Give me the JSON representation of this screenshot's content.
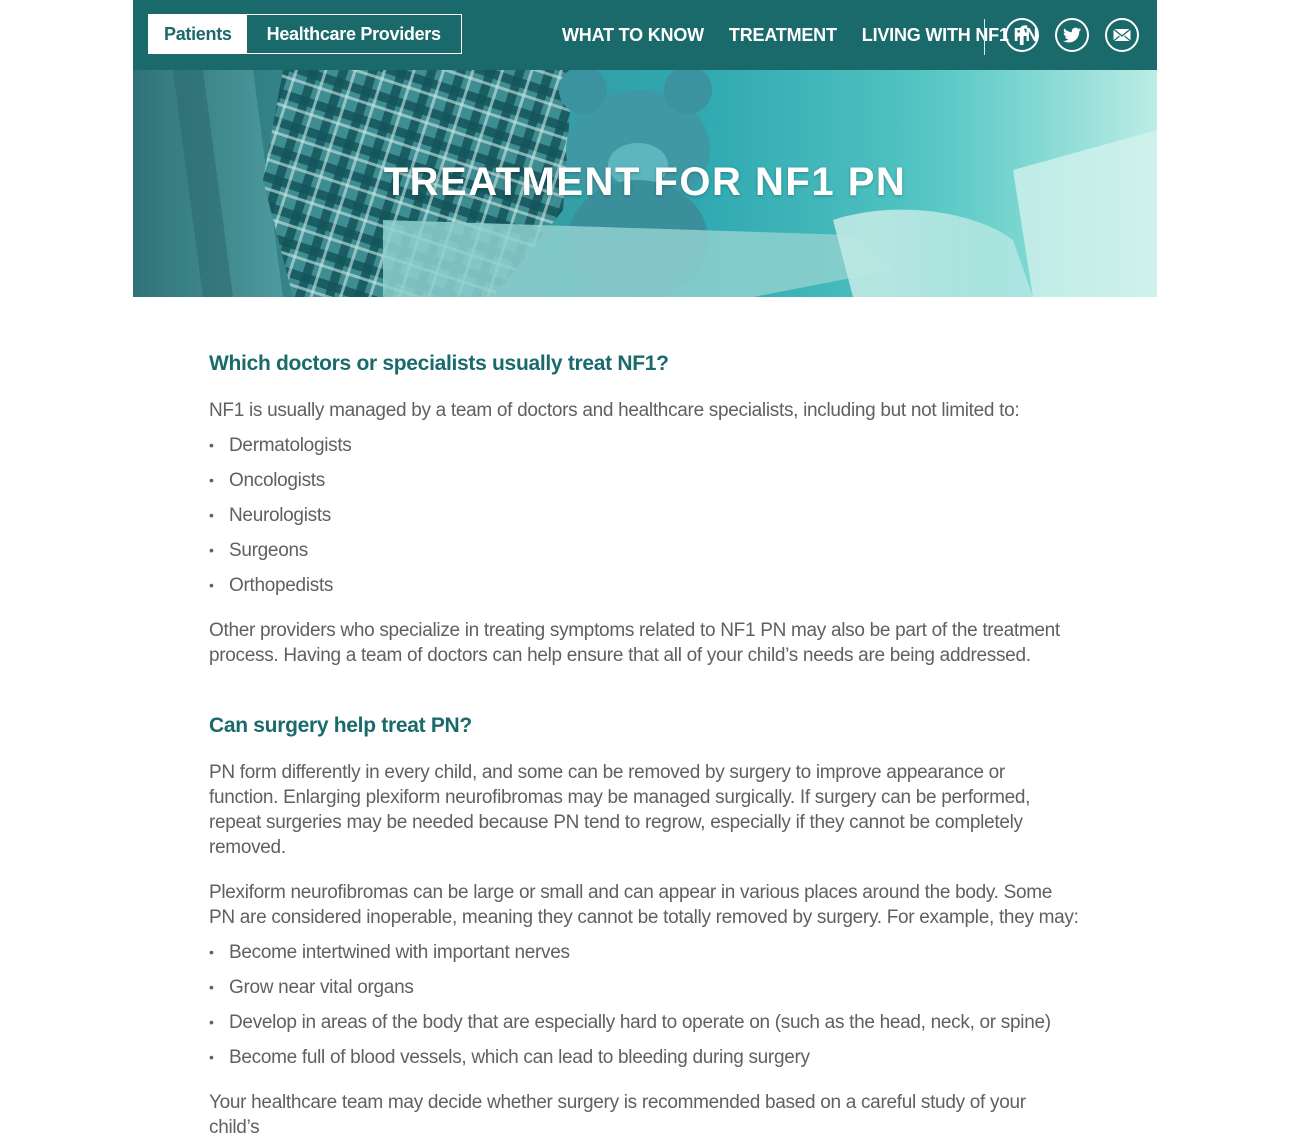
{
  "header": {
    "audience_tabs": [
      {
        "label": "Patients"
      },
      {
        "label": "Healthcare Providers"
      }
    ],
    "nav": [
      {
        "label": "WHAT TO KNOW"
      },
      {
        "label": "TREATMENT"
      },
      {
        "label": "LIVING WITH NF1 PN"
      }
    ],
    "social_icons": [
      "facebook-icon",
      "twitter-icon",
      "email-icon"
    ]
  },
  "hero": {
    "title": "TREATMENT FOR NF1 PN"
  },
  "section1": {
    "heading": "Which doctors or specialists usually treat NF1?",
    "intro": "NF1 is usually managed by a team of doctors and healthcare specialists, including but not limited to:",
    "list": [
      "Dermatologists",
      "Oncologists",
      "Neurologists",
      "Surgeons",
      "Orthopedists"
    ],
    "para": "Other providers who specialize in treating symptoms related to NF1 PN may also be part of the treatment process. Having a team of doctors can help ensure that all of your child’s needs are being addressed."
  },
  "section2": {
    "heading": "Can surgery help treat PN?",
    "para1": "PN form differently in every child, and some can be removed by surgery to improve appearance or function. Enlarging plexiform neurofibromas may be managed surgically. If surgery can be performed, repeat surgeries may be needed because PN tend to regrow, especially if they cannot be completely removed.",
    "para2": "Plexiform neurofibromas can be large or small and can appear in various places around the body. Some PN are considered inoperable, meaning they cannot be totally removed by surgery. For example, they may:",
    "list": [
      "Become intertwined with important nerves",
      "Grow near vital organs",
      "Develop in areas of the body that are especially hard to operate on (such as the head, neck, or spine)",
      "Become full of blood vessels, which can lead to bleeding during surgery"
    ],
    "para3": "Your healthcare team may decide whether surgery is recommended based on a careful study of your child’s"
  },
  "colors": {
    "brand_teal": "#1a6a6b",
    "body_text": "#5e6062",
    "white": "#ffffff"
  }
}
